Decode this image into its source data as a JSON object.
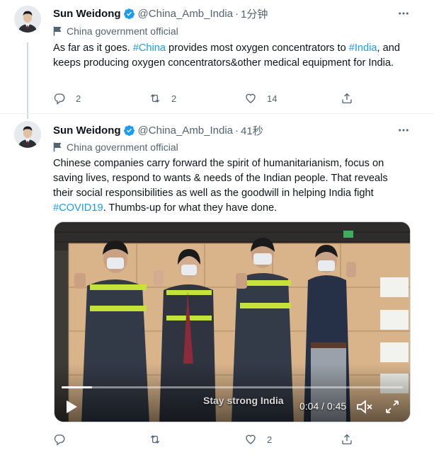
{
  "tweets": [
    {
      "author_name": "Sun Weidong",
      "handle": "@China_Amb_India",
      "separator": "·",
      "time": "1分钟",
      "label": "China government official",
      "text_parts": [
        {
          "t": "As far as it goes. ",
          "tag": false
        },
        {
          "t": "#China",
          "tag": true
        },
        {
          "t": " provides most oxygen concentrators to ",
          "tag": false
        },
        {
          "t": "#India",
          "tag": true
        },
        {
          "t": ", and keeps producing oxygen concentrators&other medical equipment for India.",
          "tag": false
        }
      ],
      "replies": "2",
      "retweets": "2",
      "likes": "14"
    },
    {
      "author_name": "Sun Weidong",
      "handle": "@China_Amb_India",
      "separator": "·",
      "time": "41秒",
      "label": "China government official",
      "text_parts": [
        {
          "t": "Chinese companies carry forward the spirit of humanitarianism,  focus on saving lives, respond to  wants & needs of the Indian people. That reveals their social responsibilities as well as the goodwill in helping India fight ",
          "tag": false
        },
        {
          "t": "#COVID19",
          "tag": true
        },
        {
          "t": ". Thumbs-up for what they have done.",
          "tag": false
        }
      ],
      "replies": "",
      "retweets": "",
      "likes": "2",
      "video": {
        "caption": "Stay strong India",
        "timecode": "0:04 / 0:45",
        "progress": 0.09
      }
    }
  ],
  "icons": {
    "verified": "verified-badge-icon",
    "label": "flag-icon",
    "reply": "reply-icon",
    "retweet": "retweet-icon",
    "like": "heart-icon",
    "share": "share-icon",
    "more": "more-icon",
    "play": "play-icon",
    "volume": "volume-icon",
    "fullscreen": "fullscreen-icon"
  },
  "colors": {
    "accent": "#1d9bf0",
    "secondary_text": "#536471",
    "primary_text": "#0f1419"
  }
}
